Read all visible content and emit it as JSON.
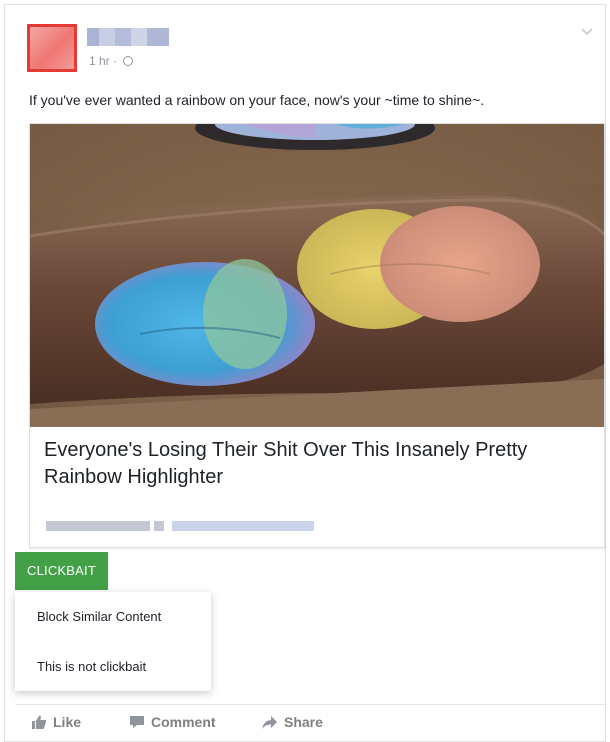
{
  "post": {
    "timestamp": "1 hr",
    "separator": " · ",
    "text": "If you've ever wanted a rainbow on your face, now's your ~time to shine~."
  },
  "link_card": {
    "title": "Everyone's Losing Their Shit Over This Insanely Pretty Rainbow Highlighter"
  },
  "clickbait": {
    "tag_label": "CLICKBAIT",
    "tag_color": "#43a047",
    "menu_items": [
      {
        "label": "Block Similar Content"
      },
      {
        "label": "This is not clickbait"
      }
    ]
  },
  "actions": [
    {
      "label": "Like",
      "icon": "thumbs-up-icon"
    },
    {
      "label": "Comment",
      "icon": "comment-icon"
    },
    {
      "label": "Share",
      "icon": "share-arrow-icon"
    }
  ]
}
